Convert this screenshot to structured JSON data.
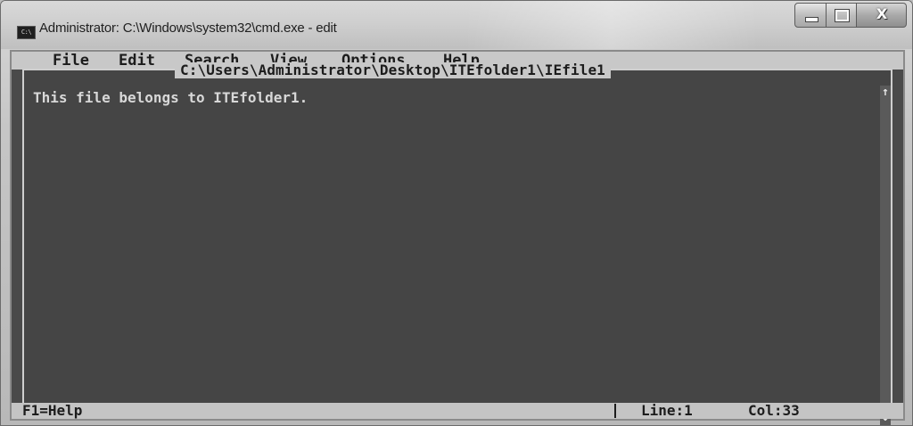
{
  "window": {
    "title": "Administrator: C:\\Windows\\system32\\cmd.exe - edit",
    "icon_text": "C:\\",
    "icon_name": "cmd-app-icon",
    "buttons": {
      "minimize_icon": "minimize-icon",
      "maximize_icon": "maximize-icon",
      "close_label": "X"
    }
  },
  "menu": {
    "items": [
      {
        "label": "File"
      },
      {
        "label": "Edit"
      },
      {
        "label": "Search"
      },
      {
        "label": "View"
      },
      {
        "label": "Options"
      },
      {
        "label": "Help"
      }
    ]
  },
  "editor": {
    "file_path": "C:\\Users\\Administrator\\Desktop\\ITEfolder1\\IEfile1",
    "lines": [
      "This file belongs to ITEfolder1."
    ],
    "scroll_up": "↑",
    "scroll_down": "↓"
  },
  "status": {
    "help": "F1=Help",
    "line": "Line:1",
    "col": "Col:33"
  },
  "colors": {
    "console_background": "#4a4a4a",
    "bar_background": "#c8c8c8",
    "text_light": "#d8d8d8",
    "text_dark": "#1c1c1c"
  }
}
